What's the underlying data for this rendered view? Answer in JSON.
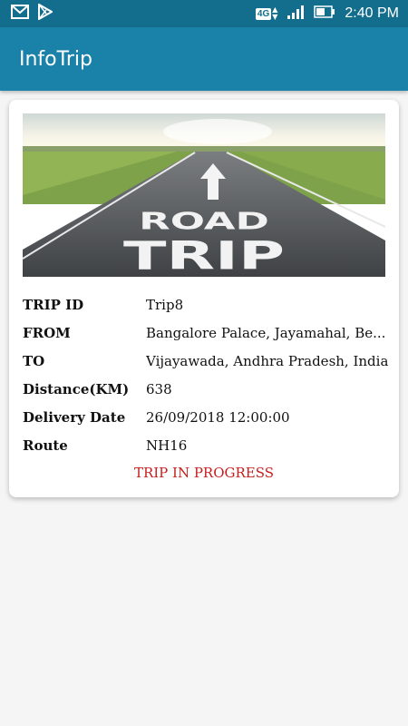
{
  "status_bar": {
    "icons_left": [
      "gmail-icon",
      "play-store-icon"
    ],
    "network": "4G",
    "time": "2:40 PM"
  },
  "app_bar": {
    "title": "InfoTrip"
  },
  "card": {
    "image_text": [
      "ROAD",
      "TRIP"
    ],
    "rows": [
      {
        "label": "TRIP ID",
        "value": "Trip8"
      },
      {
        "label": "FROM",
        "value": "Bangalore Palace, Jayamahal, Be..."
      },
      {
        "label": "TO",
        "value": "Vijayawada, Andhra Pradesh, India"
      },
      {
        "label": "Distance(KM)",
        "value": "638"
      },
      {
        "label": "Delivery Date",
        "value": "26/09/2018 12:00:00"
      },
      {
        "label": "Route",
        "value": "NH16"
      }
    ],
    "status": "TRIP IN PROGRESS"
  },
  "colors": {
    "status_bar": "#136d8c",
    "app_bar": "#1a82a8",
    "status_text": "#c81e1e"
  }
}
